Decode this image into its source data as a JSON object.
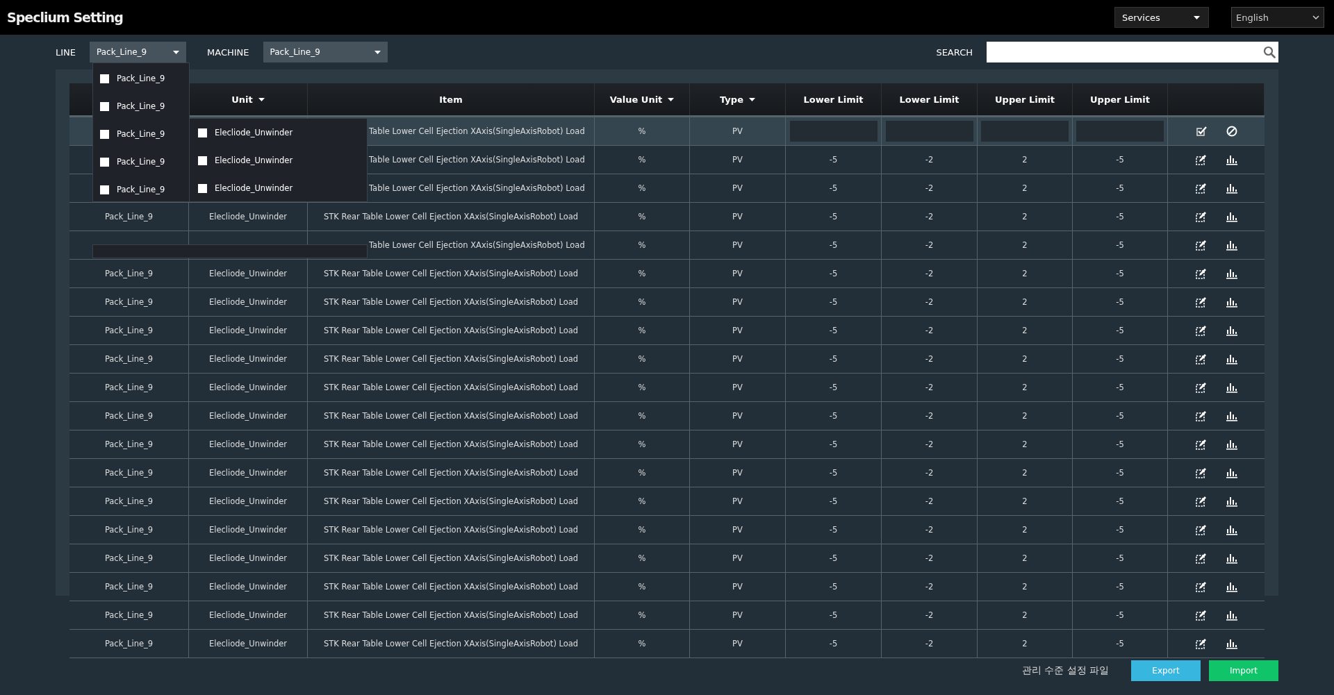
{
  "window": {
    "title": "Speclium Setting"
  },
  "top_bar": {
    "services": "Services",
    "language": "English"
  },
  "filters": {
    "line_label": "LINE",
    "line_value": "Pack_Line_9",
    "machine_label": "MACHINE",
    "machine_value": "Pack_Line_9",
    "search_label": "SEARCH"
  },
  "line_dropdown": {
    "items": [
      {
        "label": "Pack_Line_9",
        "checked": false
      },
      {
        "label": "Pack_Line_9",
        "checked": false
      },
      {
        "label": "Pack_Line_9",
        "checked": false
      },
      {
        "label": "Pack_Line_9",
        "checked": false
      },
      {
        "label": "Pack_Line_9",
        "checked": false
      }
    ]
  },
  "unit_dropdown": {
    "items": [
      {
        "label": "Elecliode_Unwinder",
        "checked": false
      },
      {
        "label": "Elecliode_Unwinder",
        "checked": false
      },
      {
        "label": "Elecliode_Unwinder",
        "checked": false
      }
    ]
  },
  "table": {
    "columns": [
      {
        "label": "Unit",
        "sortable": true
      },
      {
        "label": "Item",
        "sortable": false
      },
      {
        "label": "Value Unit",
        "sortable": true
      },
      {
        "label": "Type",
        "sortable": true
      },
      {
        "label": "Lower Limit",
        "sortable": false
      },
      {
        "label": "Lower Limit",
        "sortable": false
      },
      {
        "label": "Upper Limit",
        "sortable": false
      },
      {
        "label": "Upper Limit",
        "sortable": false
      }
    ],
    "rows": [
      {
        "item": "Table Lower Cell Ejection XAxis(SingleAxisRobot) Load",
        "value_unit": "%",
        "type": "PV",
        "editing": true
      },
      {
        "item": "Table Lower Cell Ejection XAxis(SingleAxisRobot) Load",
        "value_unit": "%",
        "type": "PV",
        "lower_1": "-5",
        "lower_2": "-2",
        "upper_1": "2",
        "upper_2": "-5",
        "editing": false
      },
      {
        "item": "Table Lower Cell Ejection XAxis(SingleAxisRobot) Load",
        "value_unit": "%",
        "type": "PV",
        "lower_1": "-5",
        "lower_2": "-2",
        "upper_1": "2",
        "upper_2": "-5",
        "editing": false
      },
      {
        "line": "Pack_Line_9",
        "unit": "Elecliode_Unwinder",
        "item": "STK Rear Table Lower Cell Ejection XAxis(SingleAxisRobot) Load",
        "value_unit": "%",
        "type": "PV",
        "lower_1": "-5",
        "lower_2": "-2",
        "upper_1": "2",
        "upper_2": "-5",
        "editing": false
      },
      {
        "item": "Table Lower Cell Ejection XAxis(SingleAxisRobot) Load",
        "value_unit": "%",
        "type": "PV",
        "lower_1": "-5",
        "lower_2": "-2",
        "upper_1": "2",
        "upper_2": "-5",
        "editing": false
      },
      {
        "line": "Pack_Line_9",
        "unit": "Elecliode_Unwinder",
        "item": "STK Rear Table Lower Cell Ejection XAxis(SingleAxisRobot) Load",
        "value_unit": "%",
        "type": "PV",
        "lower_1": "-5",
        "lower_2": "-2",
        "upper_1": "2",
        "upper_2": "-5",
        "editing": false
      },
      {
        "line": "Pack_Line_9",
        "unit": "Elecliode_Unwinder",
        "item": "STK Rear Table Lower Cell Ejection XAxis(SingleAxisRobot) Load",
        "value_unit": "%",
        "type": "PV",
        "lower_1": "-5",
        "lower_2": "-2",
        "upper_1": "2",
        "upper_2": "-5",
        "editing": false
      },
      {
        "line": "Pack_Line_9",
        "unit": "Elecliode_Unwinder",
        "item": "STK Rear Table Lower Cell Ejection XAxis(SingleAxisRobot) Load",
        "value_unit": "%",
        "type": "PV",
        "lower_1": "-5",
        "lower_2": "-2",
        "upper_1": "2",
        "upper_2": "-5",
        "editing": false
      },
      {
        "line": "Pack_Line_9",
        "unit": "Elecliode_Unwinder",
        "item": "STK Rear Table Lower Cell Ejection XAxis(SingleAxisRobot) Load",
        "value_unit": "%",
        "type": "PV",
        "lower_1": "-5",
        "lower_2": "-2",
        "upper_1": "2",
        "upper_2": "-5",
        "editing": false
      },
      {
        "line": "Pack_Line_9",
        "unit": "Elecliode_Unwinder",
        "item": "STK Rear Table Lower Cell Ejection XAxis(SingleAxisRobot) Load",
        "value_unit": "%",
        "type": "PV",
        "lower_1": "-5",
        "lower_2": "-2",
        "upper_1": "2",
        "upper_2": "-5",
        "editing": false
      },
      {
        "line": "Pack_Line_9",
        "unit": "Elecliode_Unwinder",
        "item": "STK Rear Table Lower Cell Ejection XAxis(SingleAxisRobot) Load",
        "value_unit": "%",
        "type": "PV",
        "lower_1": "-5",
        "lower_2": "-2",
        "upper_1": "2",
        "upper_2": "-5",
        "editing": false
      },
      {
        "line": "Pack_Line_9",
        "unit": "Elecliode_Unwinder",
        "item": "STK Rear Table Lower Cell Ejection XAxis(SingleAxisRobot) Load",
        "value_unit": "%",
        "type": "PV",
        "lower_1": "-5",
        "lower_2": "-2",
        "upper_1": "2",
        "upper_2": "-5",
        "editing": false
      },
      {
        "line": "Pack_Line_9",
        "unit": "Elecliode_Unwinder",
        "item": "STK Rear Table Lower Cell Ejection XAxis(SingleAxisRobot) Load",
        "value_unit": "%",
        "type": "PV",
        "lower_1": "-5",
        "lower_2": "-2",
        "upper_1": "2",
        "upper_2": "-5",
        "editing": false
      },
      {
        "line": "Pack_Line_9",
        "unit": "Elecliode_Unwinder",
        "item": "STK Rear Table Lower Cell Ejection XAxis(SingleAxisRobot) Load",
        "value_unit": "%",
        "type": "PV",
        "lower_1": "-5",
        "lower_2": "-2",
        "upper_1": "2",
        "upper_2": "-5",
        "editing": false
      },
      {
        "line": "Pack_Line_9",
        "unit": "Elecliode_Unwinder",
        "item": "STK Rear Table Lower Cell Ejection XAxis(SingleAxisRobot) Load",
        "value_unit": "%",
        "type": "PV",
        "lower_1": "-5",
        "lower_2": "-2",
        "upper_1": "2",
        "upper_2": "-5",
        "editing": false
      },
      {
        "line": "Pack_Line_9",
        "unit": "Elecliode_Unwinder",
        "item": "STK Rear Table Lower Cell Ejection XAxis(SingleAxisRobot) Load",
        "value_unit": "%",
        "type": "PV",
        "lower_1": "-5",
        "lower_2": "-2",
        "upper_1": "2",
        "upper_2": "-5",
        "editing": false
      },
      {
        "line": "Pack_Line_9",
        "unit": "Elecliode_Unwinder",
        "item": "STK Rear Table Lower Cell Ejection XAxis(SingleAxisRobot) Load",
        "value_unit": "%",
        "type": "PV",
        "lower_1": "-5",
        "lower_2": "-2",
        "upper_1": "2",
        "upper_2": "-5",
        "editing": false
      },
      {
        "line": "Pack_Line_9",
        "unit": "Elecliode_Unwinder",
        "item": "STK Rear Table Lower Cell Ejection XAxis(SingleAxisRobot) Load",
        "value_unit": "%",
        "type": "PV",
        "lower_1": "-5",
        "lower_2": "-2",
        "upper_1": "2",
        "upper_2": "-5",
        "editing": false
      },
      {
        "line": "Pack_Line_9",
        "unit": "Elecliode_Unwinder",
        "item": "STK Rear Table Lower Cell Ejection XAxis(SingleAxisRobot) Load",
        "value_unit": "%",
        "type": "PV",
        "lower_1": "-5",
        "lower_2": "-2",
        "upper_1": "2",
        "upper_2": "-5",
        "editing": false
      }
    ]
  },
  "footer": {
    "caption": "관리 수준 설정 파일",
    "export": "Export",
    "import": "Import"
  }
}
